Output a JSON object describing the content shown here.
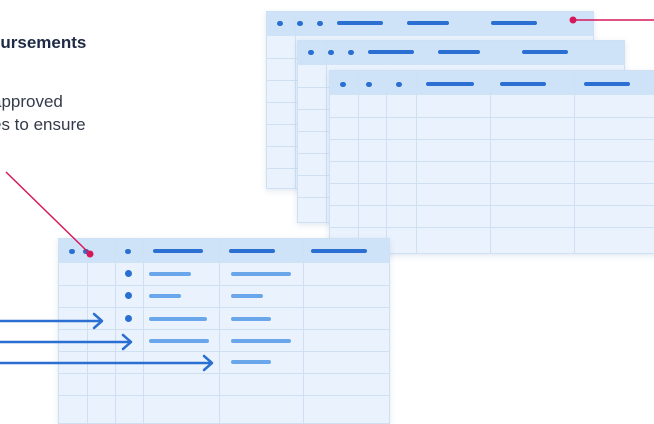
{
  "heading": {
    "title": "oursements"
  },
  "description": {
    "line1": "approved",
    "line2": "es to ensure"
  },
  "colors": {
    "sheet_bg": "#eaf3fd",
    "header_bg": "#cfe3f8",
    "accent": "#2a6fd1",
    "connector": "#d6185a"
  }
}
